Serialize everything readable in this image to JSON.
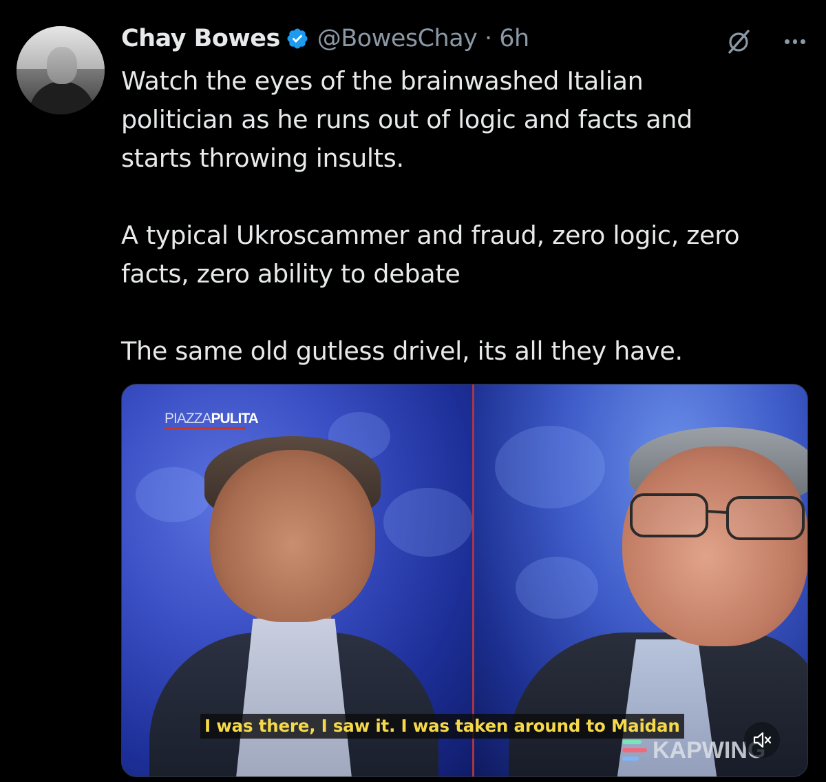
{
  "tweet": {
    "author_name": "Chay Bowes",
    "handle_time": "@BowesChay · 6h",
    "verified": true,
    "paragraphs": [
      "Watch the eyes of the brainwashed Italian\npolitician as he runs out of logic and facts and\nstarts throwing insults.",
      "A typical Ukroscammer and fraud, zero logic, zero\nfacts, zero ability to debate",
      "The same old gutless drivel, its all they have."
    ]
  },
  "icons": {
    "verified": "verified-badge-icon",
    "grok": "grok-icon",
    "more": "more-options-icon",
    "mute": "muted-speaker-icon"
  },
  "colors": {
    "background": "#000000",
    "text": "#e7e9ea",
    "secondary": "#8b98a5",
    "verified_blue": "#1d9bf0",
    "subtitle_yellow": "#f6d94a"
  },
  "media": {
    "show_logo_prefix": "PIAZZA",
    "show_logo_suffix": "PULITA",
    "subtitle": "I was there, I saw it. I was taken around to Maidan",
    "watermark": "KAPWING"
  }
}
